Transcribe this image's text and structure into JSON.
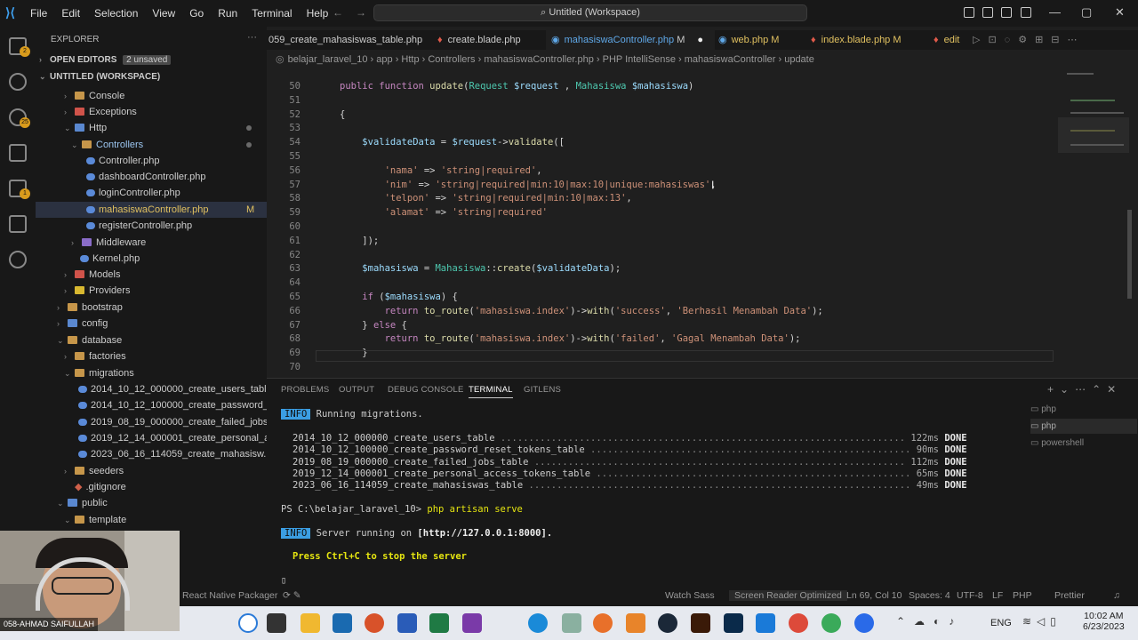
{
  "menu": [
    "File",
    "Edit",
    "Selection",
    "View",
    "Go",
    "Run",
    "Terminal",
    "Help"
  ],
  "command_center": "Untitled (Workspace)",
  "explorer": {
    "title": "EXPLORER",
    "open_editors": "OPEN EDITORS",
    "unsaved": "2 unsaved",
    "workspace": "UNTITLED (WORKSPACE)",
    "items": [
      {
        "label": "Console",
        "kind": "folder"
      },
      {
        "label": "Exceptions",
        "kind": "folder"
      },
      {
        "label": "Http",
        "kind": "folder"
      },
      {
        "label": "Controllers",
        "kind": "folder"
      },
      {
        "label": "Controller.php",
        "kind": "file"
      },
      {
        "label": "dashboardController.php",
        "kind": "file"
      },
      {
        "label": "loginController.php",
        "kind": "file"
      },
      {
        "label": "mahasiswaController.php",
        "kind": "file",
        "status": "M"
      },
      {
        "label": "registerController.php",
        "kind": "file"
      },
      {
        "label": "Middleware",
        "kind": "folder"
      },
      {
        "label": "Kernel.php",
        "kind": "file"
      },
      {
        "label": "Models",
        "kind": "folder"
      },
      {
        "label": "Providers",
        "kind": "folder"
      },
      {
        "label": "bootstrap",
        "kind": "folder"
      },
      {
        "label": "config",
        "kind": "folder"
      },
      {
        "label": "database",
        "kind": "folder"
      },
      {
        "label": "factories",
        "kind": "folder"
      },
      {
        "label": "migrations",
        "kind": "folder"
      },
      {
        "label": "2014_10_12_000000_create_users_tabl...",
        "kind": "file"
      },
      {
        "label": "2014_10_12_100000_create_password_...",
        "kind": "file"
      },
      {
        "label": "2019_08_19_000000_create_failed_jobs...",
        "kind": "file"
      },
      {
        "label": "2019_12_14_000001_create_personal_a...",
        "kind": "file"
      },
      {
        "label": "2023_06_16_114059_create_mahasisw...",
        "kind": "file"
      },
      {
        "label": "seeders",
        "kind": "folder"
      },
      {
        "label": ".gitignore",
        "kind": "file"
      },
      {
        "label": "public",
        "kind": "folder"
      },
      {
        "label": "template",
        "kind": "folder"
      }
    ]
  },
  "tabs": [
    {
      "label": "059_create_mahasiswas_table.php"
    },
    {
      "label": "create.blade.php"
    },
    {
      "label": "mahasiswaController.php",
      "status": "M"
    },
    {
      "label": "web.php",
      "status": "M"
    },
    {
      "label": "index.blade.php",
      "status": "M"
    },
    {
      "label": "edit"
    }
  ],
  "breadcrumb": "belajar_laravel_10 › app › Http › Controllers › mahasiswaController.php › PHP IntelliSense › mahasiswaController › update",
  "code_lines": [
    {
      "n": "50",
      "t": "public function update(Request $request , Mahasiswa $mahasiswa)"
    },
    {
      "n": "51",
      "t": ""
    },
    {
      "n": "52",
      "t": "{"
    },
    {
      "n": "53",
      "t": ""
    },
    {
      "n": "54",
      "t": "    $validateData = $request->validate(["
    },
    {
      "n": "55",
      "t": ""
    },
    {
      "n": "56",
      "t": "        'nama' => 'string|required',"
    },
    {
      "n": "57",
      "t": "        'nim' => 'string|required|min:10|max:10|unique:mahasiswas',"
    },
    {
      "n": "58",
      "t": "        'telpon' => 'string|required|min:10|max:13',"
    },
    {
      "n": "59",
      "t": "        'alamat' => 'string|required'"
    },
    {
      "n": "60",
      "t": ""
    },
    {
      "n": "61",
      "t": "    ]);"
    },
    {
      "n": "62",
      "t": ""
    },
    {
      "n": "63",
      "t": "    $mahasiswa = Mahasiswa::create($validateData);"
    },
    {
      "n": "64",
      "t": ""
    },
    {
      "n": "65",
      "t": "    if ($mahasiswa) {"
    },
    {
      "n": "66",
      "t": "        return to_route('mahasiswa.index')->with('success', 'Berhasil Menambah Data');"
    },
    {
      "n": "67",
      "t": "    } else {"
    },
    {
      "n": "68",
      "t": "        return to_route('mahasiswa.index')->with('failed', 'Gagal Menambah Data');"
    },
    {
      "n": "69",
      "t": "    }"
    },
    {
      "n": "70",
      "t": ""
    }
  ],
  "panel_tabs": [
    "PROBLEMS",
    "OUTPUT",
    "DEBUG CONSOLE",
    "TERMINAL",
    "GITLENS"
  ],
  "terminal": {
    "info_label": "INFO",
    "running": "Running migrations.",
    "migrations": [
      {
        "name": "2014_10_12_000000_create_users_table",
        "time": "122ms",
        "status": "DONE"
      },
      {
        "name": "2014_10_12_100000_create_password_reset_tokens_table",
        "time": "90ms",
        "status": "DONE"
      },
      {
        "name": "2019_08_19_000000_create_failed_jobs_table",
        "time": "112ms",
        "status": "DONE"
      },
      {
        "name": "2019_12_14_000001_create_personal_access_tokens_table",
        "time": "65ms",
        "status": "DONE"
      },
      {
        "name": "2023_06_16_114059_create_mahasiswas_table",
        "time": "49ms",
        "status": "DONE"
      }
    ],
    "prompt": "PS C:\\belajar_laravel_10> ",
    "command": "php artisan serve",
    "server_prefix": "Server running on ",
    "server_url": "[http://127.0.0.1:8000].",
    "stop_hint": "Press Ctrl+C to stop the server",
    "instances": [
      "php",
      "php",
      "powershell"
    ]
  },
  "statusbar": {
    "left": "React Native Packager",
    "watch_sass": "Watch Sass",
    "screen_reader": "Screen Reader Optimized",
    "position": "Ln 69, Col 10",
    "spaces": "Spaces: 4",
    "encoding": "UTF-8",
    "eol": "LF",
    "language": "PHP",
    "prettier": "Prettier"
  },
  "webcam_name": "058-AHMAD SAIFULLAH",
  "taskbar": {
    "lang": "ENG",
    "time": "10:02 AM",
    "date": "6/23/2023"
  }
}
